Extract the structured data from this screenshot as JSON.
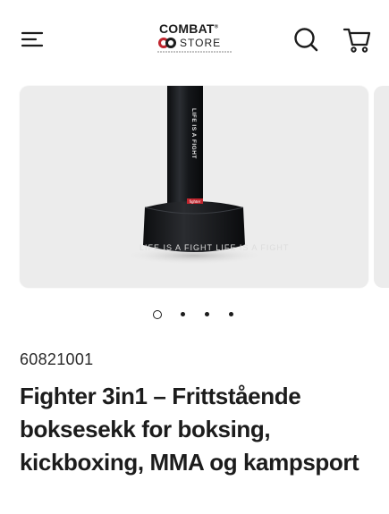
{
  "header": {
    "menu_icon": "hamburger-menu-icon",
    "logo": {
      "line1": "COMBAT",
      "trademark": "®",
      "line2": "STORE"
    },
    "search_icon": "search-icon",
    "cart_icon": "shopping-cart-icon"
  },
  "product": {
    "image_text": {
      "vertical_print": "LIFE IS A FIGHT",
      "base_print": "LIFE IS A FIGHT   LIFE IS A FIGHT",
      "tag": "fighter"
    },
    "carousel": {
      "count": 4,
      "active_index": 0
    },
    "sku": "60821001",
    "title": "Fighter 3in1 – Frittstående boksesekk for boksing, kickboxing, MMA og kampsport"
  },
  "colors": {
    "text": "#1c1c1c",
    "image_bg": "#ececec",
    "bag": "#16181b",
    "tag_red": "#c0252e"
  }
}
